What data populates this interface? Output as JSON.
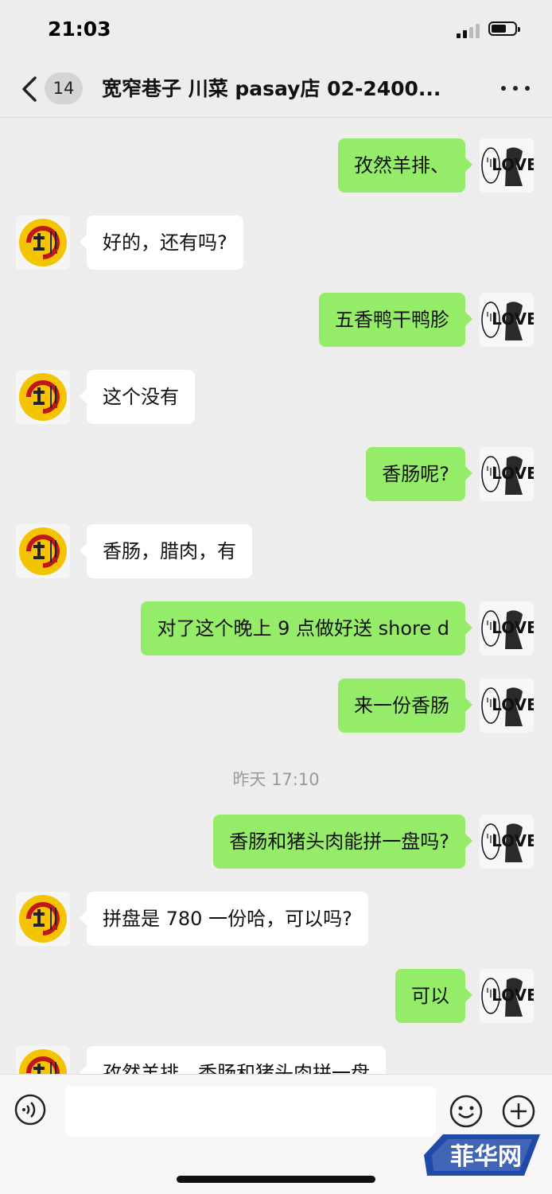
{
  "status_bar": {
    "time": "21:03"
  },
  "nav": {
    "unread_count": "14",
    "title": "宽窄巷子 川菜 pasay店 02-2400..."
  },
  "messages": [
    {
      "side": "out",
      "text": "孜然羊排、"
    },
    {
      "side": "in",
      "text": "好的，还有吗?"
    },
    {
      "side": "out",
      "text": "五香鸭干鸭胗"
    },
    {
      "side": "in",
      "text": "这个没有"
    },
    {
      "side": "out",
      "text": "香肠呢?"
    },
    {
      "side": "in",
      "text": "香肠，腊肉，有"
    },
    {
      "side": "out",
      "text": "对了这个晚上 9 点做好送 shore d"
    },
    {
      "side": "out",
      "text": "来一份香肠"
    },
    {
      "side": "out",
      "text": "香肠和猪头肉能拼一盘吗?"
    },
    {
      "side": "in",
      "text": "拼盘是 780 一份哈，可以吗?"
    },
    {
      "side": "out",
      "text": "可以"
    },
    {
      "side": "in",
      "text": "孜然羊排、香肠和猪头肉拼一盘"
    }
  ],
  "timestamp": "昨天 17:10",
  "avatars": {
    "self_text": "LOVE",
    "shop_logo_colors": {
      "ring": "#f5c400",
      "mark": "#c0171c"
    }
  },
  "input": {
    "value": ""
  },
  "watermark": {
    "text": "菲华网"
  },
  "colors": {
    "outgoing_bubble": "#95ec69",
    "incoming_bubble": "#ffffff",
    "background": "#ededed"
  }
}
